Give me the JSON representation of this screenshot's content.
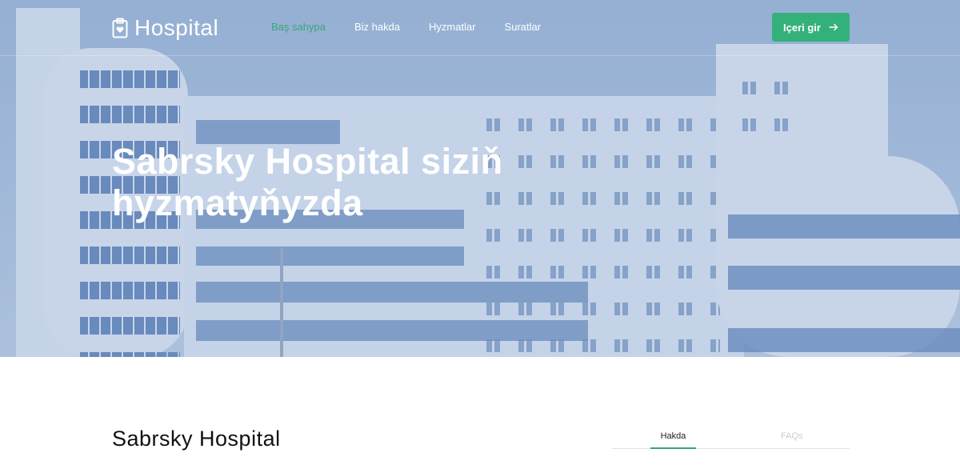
{
  "header": {
    "logo_text": "Hospital",
    "logo_icon": "clipboard-heart-icon",
    "nav": [
      {
        "label": "Baş sahypa",
        "active": true
      },
      {
        "label": "Biz hakda",
        "active": false
      },
      {
        "label": "Hyzmatlar",
        "active": false
      },
      {
        "label": "Suratlar",
        "active": false
      }
    ],
    "login_label": "Içeri gir",
    "login_icon": "arrow-right-icon"
  },
  "hero": {
    "title": "Sabrsky Hospital siziň hyzmatyňyzda"
  },
  "about": {
    "title": "Sabrsky Hospital",
    "tabs": [
      {
        "label": "Hakda",
        "active": true
      },
      {
        "label": "FAQs",
        "active": false
      }
    ]
  },
  "colors": {
    "accent": "#34b17a",
    "active_link": "#3aa57a",
    "hero_tint": "#b9c9de"
  }
}
